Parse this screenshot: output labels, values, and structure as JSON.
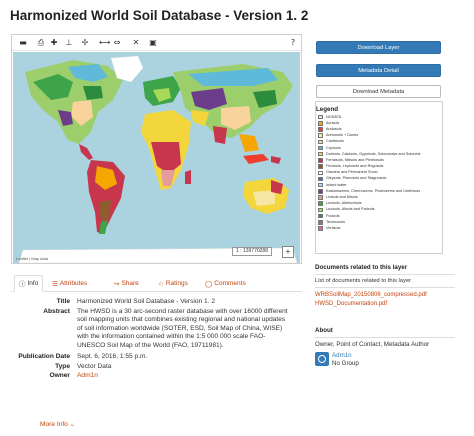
{
  "page": {
    "title": "Harmonized World Soil Database - Version 1. 2"
  },
  "map": {
    "toolbar_icons": [
      "layers-icon",
      "print-icon",
      "zoom-in-icon",
      "zoom-out-icon",
      "pan-icon",
      "full-extent-icon",
      "measure-icon",
      "vector-tools-icon",
      "help-icon"
    ],
    "scale": "1 : 139770288",
    "zoom_label": "+",
    "attribution": "Leaflet | Map data"
  },
  "actions": {
    "download_layer": "Download Layer",
    "metadata_detail": "Metadata Detail",
    "download_metadata": "Download Metadata"
  },
  "legend": {
    "title": "Legend",
    "items": [
      {
        "label": "NODATA",
        "color": "#e8e4ef"
      },
      {
        "label": "Acrisols",
        "color": "#f6a600"
      },
      {
        "label": "Andosols",
        "color": "#ef3d2f"
      },
      {
        "label": "Arenosols + Dunes",
        "color": "#f5e6a3"
      },
      {
        "label": "Cambisols",
        "color": "#f8d49c"
      },
      {
        "label": "Cryosols",
        "color": "#5fb9d9"
      },
      {
        "label": "Durisols, Calcisols, Gypsisols, Solonchaks and Solonetz",
        "color": "#f3d63c"
      },
      {
        "label": "Ferralsols, Nitisols and Plinthosols",
        "color": "#c7364d"
      },
      {
        "label": "Fluvisols, Leptosols and Regosols",
        "color": "#8e5c2f"
      },
      {
        "label": "Glaciers and Permanent Snow",
        "color": "#ffffff"
      },
      {
        "label": "Gleysols, Planosols and Stagnosols",
        "color": "#3f73b5"
      },
      {
        "label": "Inland water",
        "color": "#b3d9f2"
      },
      {
        "label": "Kastanozems, Chernozems, Phaeozems and Umbrisols",
        "color": "#6b3d8a"
      },
      {
        "label": "Lixisols and Alisols",
        "color": "#e69c9c"
      },
      {
        "label": "Luvisols, Albeluvisols",
        "color": "#3da44a"
      },
      {
        "label": "Luvisols, Alisols and Podzols",
        "color": "#a6d957"
      },
      {
        "label": "Podzols",
        "color": "#2a8c3c"
      },
      {
        "label": "Technosols",
        "color": "#808080"
      },
      {
        "label": "Vertisols",
        "color": "#d66bb0"
      }
    ]
  },
  "documents": {
    "title": "Documents related to this layer",
    "subtitle": "List of documents related to this layer",
    "links": [
      "WRBSoilMap_20150806_compressed.pdf",
      "HWSD_Documentation.pdf"
    ]
  },
  "about": {
    "title": "About",
    "roles": "Owner, Point of Contact, Metadata Author",
    "owner_name": "Adm1n",
    "owner_group": "No Group"
  },
  "tabs": [
    {
      "label": "Info",
      "icon": "info-icon",
      "glyph": "ⓘ"
    },
    {
      "label": "Attributes",
      "icon": "table-icon",
      "glyph": "☰"
    },
    {
      "label": "Share",
      "icon": "share-icon",
      "glyph": "↪"
    },
    {
      "label": "Ratings",
      "icon": "star-icon",
      "glyph": "☆"
    },
    {
      "label": "Comments",
      "icon": "comment-icon",
      "glyph": "◯"
    }
  ],
  "info": {
    "title_key": "Title",
    "title_val": "Harmonized World Soil Database - Version 1. 2",
    "abstract_key": "Abstract",
    "abstract_val": "The HWSD is a 30 arc-second raster database with over 16000 different soil mapping units that combines existing regional and national updates of soil information worldwide (SOTER, ESD, Soil Map of China, WISE) with the information contained within the 1:5 000 000 scale FAO-UNESCO Soil Map of the World (FAO, 19711981).",
    "pubdate_key": "Publication Date",
    "pubdate_val": "Sept. 6, 2016, 1:55 p.m.",
    "type_key": "Type",
    "type_val": "Vector Data",
    "owner_key": "Owner",
    "owner_val": "Adm1n",
    "more_info": "More Info"
  }
}
